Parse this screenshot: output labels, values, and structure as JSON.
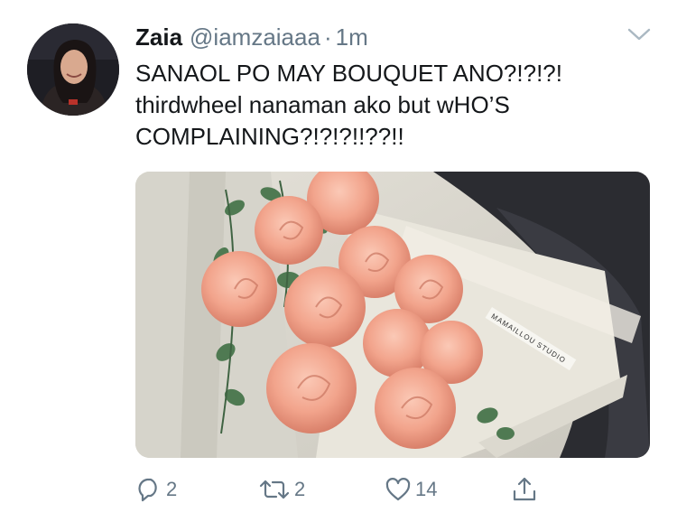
{
  "tweet": {
    "display_name": "Zaia",
    "handle": "@iamzaiaaa",
    "separator": "·",
    "time": "1m",
    "text_lines": [
      "SANAOL PO MAY BOUQUET ANO?!?!?!",
      "thirdwheel nanaman ako but wHO’S",
      "COMPLAINING?!?!?!!??!!"
    ],
    "media": {
      "subject": "bouquet of peach roses with eucalyptus wrapped in paper",
      "tag_text": "MAMAILLOU STUDIO"
    },
    "actions": {
      "reply_count": "2",
      "retweet_count": "2",
      "like_count": "14"
    }
  },
  "colors": {
    "text_primary": "#14171a",
    "text_secondary": "#657786",
    "rose": "#f0a08a",
    "leaf": "#4f7a52"
  },
  "icons": [
    "avatar",
    "chevron-down-icon",
    "reply-icon",
    "retweet-icon",
    "like-icon",
    "share-icon"
  ]
}
